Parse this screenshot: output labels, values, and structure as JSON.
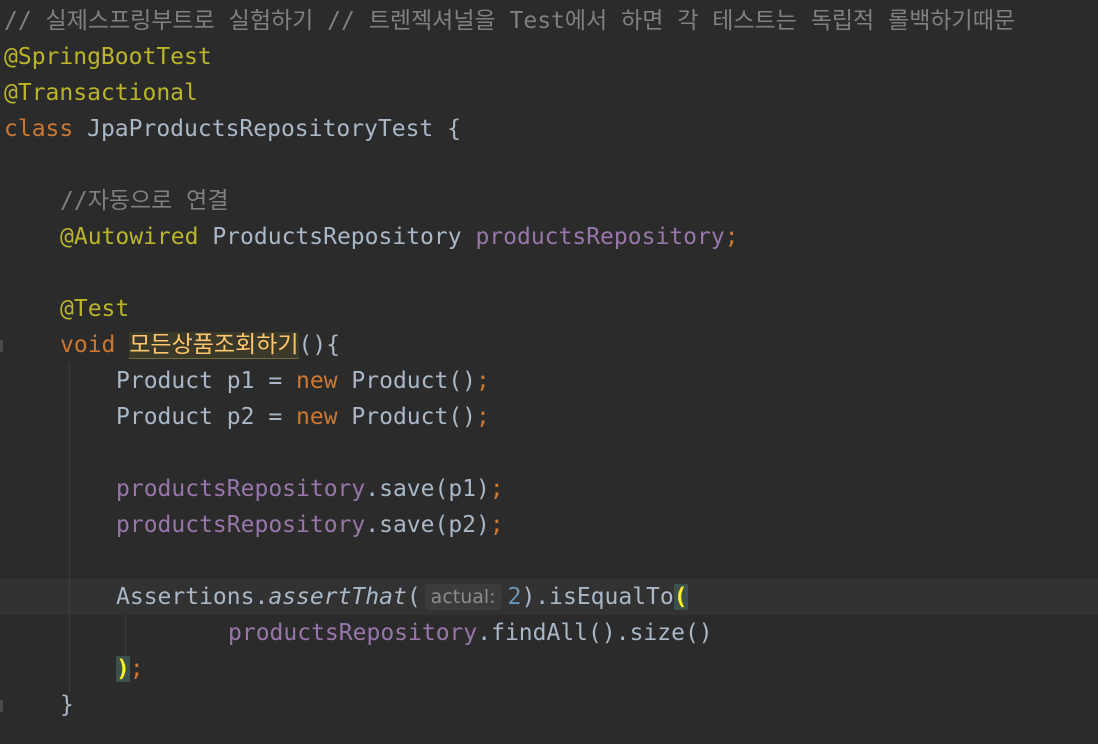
{
  "editor": {
    "comment_header": "// 실제스프링부트로 실험하기 // 트렌젝셔널을 Test에서 하면 각 테스트는 독립적 롤백하기때문",
    "anno_springboottest": "@SpringBootTest",
    "anno_transactional": "@Transactional",
    "kw_class": "class",
    "class_name": " JpaProductsRepositoryTest {",
    "comment_autowire": "//자동으로 연결",
    "anno_autowired": "@Autowired",
    "autowired_type": " ProductsRepository ",
    "field_name": "productsRepository",
    "semicolon": ";",
    "anno_test": "@Test",
    "kw_void": "void",
    "method_name": "모든상품조회하기",
    "method_tail": "(){",
    "p1_decl": "Product p1 = ",
    "p2_decl": "Product p2 = ",
    "kw_new": "new",
    "ctor_call": " Product()",
    "save_p1": ".save(p1)",
    "save_p2": ".save(p2)",
    "assert_class": "Assertions.",
    "assert_method": "assertThat",
    "open_paren": "(",
    "hint_actual": "actual:",
    "num_two": "2",
    "is_equal_to": ").isEqualTo",
    "find_all_size": ".findAll().size()",
    "close_paren": ")",
    "close_brace": "}"
  }
}
